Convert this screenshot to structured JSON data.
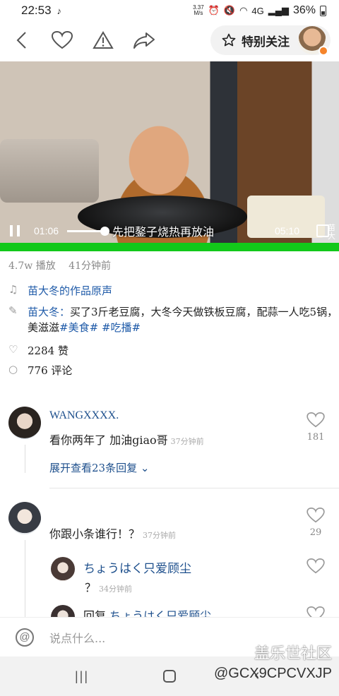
{
  "status_bar": {
    "time": "22:53",
    "speed_top": "3.37",
    "speed_unit": "M/s",
    "battery": "36%",
    "network": "4G"
  },
  "header": {
    "follow_label": "特别关注"
  },
  "video": {
    "current_time": "01:06",
    "duration": "05:10",
    "subtitle": "先把鏊子烧热再放油",
    "side_text": "苗大",
    "progress": 0.21
  },
  "stats": {
    "plays": "4.7w 播放",
    "posted": "41分钟前"
  },
  "info": {
    "audio": "苗大冬的作品原声",
    "author": "苗大冬：",
    "description": "买了3斤老豆腐，大冬今天做铁板豆腐，配蒜一人吃5锅，美滋滋",
    "tags": [
      "#美食#",
      "#吃播#"
    ],
    "likes": "2284 赞",
    "comments": "776 评论"
  },
  "comments": [
    {
      "name": "WANGXXXX.",
      "text": "看你两年了 加油giao哥",
      "time": "37分钟前",
      "likes": "181",
      "expand_label": "展开查看23条回复"
    },
    {
      "name": "",
      "text": "你跟小条谁行！？",
      "time": "37分钟前",
      "likes": "29",
      "replies": [
        {
          "name": "ちょうはく只爱顾尘",
          "text": "？",
          "time": "34分钟前"
        },
        {
          "prefix": "回复",
          "name": "ちょうはく只爱顾尘"
        }
      ]
    }
  ],
  "input": {
    "placeholder": "说点什么..."
  },
  "watermark": {
    "brand": "盖乐世社区",
    "user": "@GCX9CPCVXJP"
  },
  "colors": {
    "link": "#1d4f8c",
    "progress_bar": "#12c81a",
    "badge": "#f5842a"
  }
}
